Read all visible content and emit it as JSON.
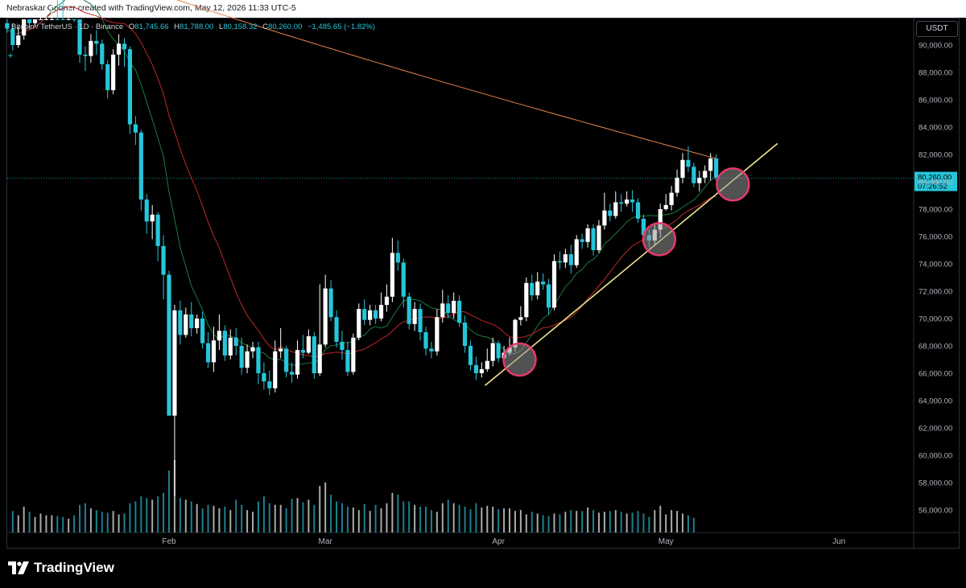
{
  "header": {
    "credit": "NebraskanGooner created with TradingView.com, May 12, 2026 11:33 UTC-5"
  },
  "legend": {
    "symbol": "Bitcoin / TetherUS · 1D · Binance",
    "o_label": "O",
    "o_value": "81,745.66",
    "h_label": "H",
    "h_value": "81,788.00",
    "l_label": "L",
    "l_value": "80,158.32",
    "c_label": "C",
    "c_value": "80,260.00",
    "change": "−1,485.65 (−1.82%)"
  },
  "currency_button": "USDT",
  "price_label": {
    "price": "80,260.00",
    "countdown": "07:26:52"
  },
  "branding": "TradingView",
  "colors": {
    "up": "#ffffff",
    "down": "#26c6da",
    "ma_long": "#e8844a",
    "ma_mid": "#c0282c",
    "ma_short": "#1e7a3a",
    "trendline": "#f0e68c",
    "circle": "#e8386b",
    "background": "#000000"
  },
  "chart_data": {
    "type": "candlestick",
    "symbol": "BTC/USDT",
    "interval": "1D",
    "y_ticks": [
      56000,
      58000,
      60000,
      62000,
      64000,
      66000,
      68000,
      70000,
      72000,
      74000,
      76000,
      78000,
      80000,
      82000,
      84000,
      86000,
      88000,
      90000
    ],
    "x_ticks": [
      {
        "label": "Feb",
        "day": 31
      },
      {
        "label": "Mar",
        "day": 59
      },
      {
        "label": "Apr",
        "day": 90
      },
      {
        "label": "May",
        "day": 120
      },
      {
        "label": "Jun",
        "day": 151
      }
    ],
    "first_date": "2026-01-01",
    "candles": [
      [
        90800,
        90600,
        91300,
        90100
      ],
      [
        90600,
        91600,
        92100,
        90400
      ],
      [
        91600,
        91200,
        92200,
        90900
      ],
      [
        91200,
        90000,
        91600,
        89600
      ],
      [
        90000,
        90700,
        91300,
        89800
      ],
      [
        90700,
        92100,
        92900,
        90400
      ],
      [
        92100,
        91600,
        92600,
        91200
      ],
      [
        91600,
        92700,
        93200,
        91300
      ],
      [
        92700,
        94300,
        95200,
        92500
      ],
      [
        94300,
        95300,
        95700,
        93800
      ],
      [
        95300,
        95500,
        96400,
        94900
      ],
      [
        95500,
        95100,
        95800,
        94600
      ],
      [
        95100,
        94100,
        95300,
        93300
      ],
      [
        94100,
        94600,
        95000,
        93600
      ],
      [
        94600,
        92200,
        94700,
        91700
      ],
      [
        92200,
        89300,
        92500,
        88700
      ],
      [
        89300,
        89200,
        89900,
        88100
      ],
      [
        89200,
        90300,
        90800,
        88700
      ],
      [
        90300,
        90100,
        91100,
        89300
      ],
      [
        90100,
        88600,
        90400,
        88200
      ],
      [
        88600,
        86700,
        88900,
        86100
      ],
      [
        86700,
        89300,
        89700,
        86400
      ],
      [
        89300,
        90100,
        90800,
        88500
      ],
      [
        90100,
        89700,
        90500,
        88400
      ],
      [
        89700,
        84200,
        89900,
        83500
      ],
      [
        84200,
        83600,
        84800,
        82700
      ],
      [
        83600,
        78700,
        83800,
        77900
      ],
      [
        78700,
        77100,
        79100,
        76200
      ],
      [
        77100,
        77600,
        78300,
        75800
      ],
      [
        77600,
        75300,
        77800,
        74200
      ],
      [
        75300,
        73200,
        76100,
        71400
      ],
      [
        73200,
        62900,
        73500,
        62900
      ],
      [
        62900,
        70600,
        71000,
        57000
      ],
      [
        70600,
        68800,
        71300,
        68100
      ],
      [
        68800,
        70300,
        70800,
        68600
      ],
      [
        70300,
        69300,
        71200,
        68700
      ],
      [
        69300,
        70000,
        70300,
        68900
      ],
      [
        70000,
        68200,
        70500,
        67800
      ],
      [
        68200,
        66800,
        69000,
        66400
      ],
      [
        66800,
        68400,
        69400,
        66100
      ],
      [
        68400,
        69100,
        70300,
        67700
      ],
      [
        69100,
        67300,
        69500,
        66900
      ],
      [
        67300,
        68600,
        69200,
        67000
      ],
      [
        68600,
        68000,
        69300,
        67300
      ],
      [
        68000,
        66400,
        68600,
        65900
      ],
      [
        66400,
        67600,
        68100,
        66000
      ],
      [
        67600,
        67900,
        68300,
        67100
      ],
      [
        67900,
        66000,
        68300,
        65200
      ],
      [
        66000,
        65400,
        66800,
        64800
      ],
      [
        65400,
        64900,
        66200,
        64400
      ],
      [
        64900,
        67600,
        68400,
        64600
      ],
      [
        67600,
        67800,
        69300,
        67100
      ],
      [
        67800,
        66100,
        68000,
        65700
      ],
      [
        66100,
        65900,
        66800,
        65300
      ],
      [
        65900,
        67700,
        68400,
        65600
      ],
      [
        67700,
        67500,
        68800,
        67100
      ],
      [
        67500,
        68700,
        69200,
        67400
      ],
      [
        68700,
        66000,
        69000,
        65600
      ],
      [
        66000,
        68100,
        72500,
        65800
      ],
      [
        68100,
        72200,
        73200,
        67900
      ],
      [
        72200,
        70100,
        72800,
        69800
      ],
      [
        70100,
        68300,
        70600,
        67900
      ],
      [
        68300,
        67700,
        69100,
        67000
      ],
      [
        67700,
        66100,
        68300,
        65800
      ],
      [
        66100,
        68600,
        68900,
        65900
      ],
      [
        68600,
        70700,
        71100,
        68400
      ],
      [
        70700,
        69900,
        71400,
        69500
      ],
      [
        69900,
        70600,
        71000,
        69500
      ],
      [
        70600,
        70000,
        71000,
        69600
      ],
      [
        70000,
        71000,
        71900,
        69800
      ],
      [
        71000,
        71600,
        72500,
        70500
      ],
      [
        71600,
        74800,
        75900,
        71200
      ],
      [
        74800,
        74100,
        75700,
        73500
      ],
      [
        74100,
        71600,
        74400,
        70800
      ],
      [
        71600,
        69600,
        71900,
        69200
      ],
      [
        69600,
        70700,
        71200,
        69100
      ],
      [
        70700,
        69000,
        71100,
        68400
      ],
      [
        69000,
        67800,
        69400,
        67300
      ],
      [
        67800,
        67600,
        68300,
        67100
      ],
      [
        67600,
        70100,
        70700,
        67300
      ],
      [
        70100,
        71100,
        72100,
        69700
      ],
      [
        71100,
        70400,
        71700,
        70000
      ],
      [
        70400,
        71300,
        71900,
        70000
      ],
      [
        71300,
        69700,
        71700,
        69400
      ],
      [
        69700,
        68000,
        70200,
        67500
      ],
      [
        68000,
        66600,
        68400,
        66200
      ],
      [
        66600,
        66000,
        67200,
        65500
      ],
      [
        66000,
        66300,
        66800,
        65700
      ],
      [
        66300,
        66900,
        67800,
        66100
      ],
      [
        66900,
        68200,
        68600,
        66500
      ],
      [
        68200,
        67100,
        68400,
        66800
      ],
      [
        67100,
        67500,
        68000,
        66900
      ],
      [
        67500,
        67900,
        68600,
        67300
      ],
      [
        67900,
        69900,
        70000,
        67600
      ],
      [
        69900,
        70100,
        70900,
        69500
      ],
      [
        70100,
        72600,
        73000,
        69800
      ],
      [
        72600,
        71700,
        73200,
        71300
      ],
      [
        71700,
        72700,
        73400,
        71400
      ],
      [
        72700,
        72500,
        73300,
        72100
      ],
      [
        72500,
        70800,
        72900,
        70300
      ],
      [
        70800,
        74200,
        74700,
        70600
      ],
      [
        74200,
        74100,
        74900,
        73600
      ],
      [
        74100,
        74700,
        75100,
        73700
      ],
      [
        74700,
        73900,
        75400,
        73300
      ],
      [
        73900,
        75800,
        76100,
        73700
      ],
      [
        75800,
        75600,
        76200,
        75100
      ],
      [
        75600,
        76600,
        76900,
        75200
      ],
      [
        76600,
        75000,
        76900,
        74600
      ],
      [
        75000,
        76800,
        77200,
        74800
      ],
      [
        76800,
        77900,
        79200,
        76500
      ],
      [
        77900,
        77500,
        78400,
        77100
      ],
      [
        77500,
        78500,
        79300,
        77300
      ],
      [
        78500,
        78400,
        79100,
        77800
      ],
      [
        78400,
        78700,
        79300,
        78200
      ],
      [
        78700,
        78500,
        79400,
        77800
      ],
      [
        78500,
        77300,
        78800,
        77000
      ],
      [
        77300,
        76100,
        77600,
        75800
      ],
      [
        76100,
        75700,
        76500,
        75200
      ],
      [
        75700,
        76500,
        77000,
        75300
      ],
      [
        76500,
        78000,
        78400,
        75900
      ],
      [
        78000,
        78300,
        79100,
        77900
      ],
      [
        78300,
        79200,
        79700,
        77900
      ],
      [
        79200,
        80300,
        80900,
        78900
      ],
      [
        80300,
        81600,
        82100,
        79900
      ],
      [
        81600,
        81100,
        82600,
        80700
      ],
      [
        81100,
        79900,
        81400,
        79600
      ],
      [
        79900,
        80300,
        80800,
        79300
      ],
      [
        80300,
        80800,
        81200,
        79900
      ],
      [
        80800,
        81700,
        82100,
        80100
      ],
      [
        81700,
        80300,
        82000,
        80100
      ]
    ],
    "volume": [
      1800,
      1500,
      1300,
      1250,
      1000,
      1500,
      1200,
      900,
      1100,
      1000,
      1000,
      950,
      900,
      800,
      1000,
      1600,
      1700,
      1400,
      1300,
      1200,
      1150,
      1250,
      1050,
      1100,
      1700,
      1800,
      2100,
      2000,
      1900,
      2100,
      2300,
      3600,
      4200,
      2000,
      1900,
      1800,
      1650,
      1400,
      1600,
      1550,
      1400,
      1500,
      1300,
      1900,
      1600,
      1300,
      1200,
      1800,
      2100,
      1700,
      1600,
      1600,
      1400,
      1950,
      2000,
      1750,
      1900,
      1600,
      2700,
      2900,
      2200,
      1800,
      1700,
      1500,
      1450,
      1300,
      1650,
      1250,
      1600,
      1400,
      1700,
      2300,
      2200,
      1800,
      1800,
      1600,
      1500,
      1500,
      1300,
      1200,
      1700,
      1900,
      1700,
      1600,
      1500,
      1350,
      1700,
      1450,
      1550,
      1500,
      1350,
      1400,
      1400,
      1250,
      1300,
      1050,
      1200,
      1100,
      1000,
      950,
      1100,
      1050,
      1200,
      1300,
      1250,
      1250,
      1450,
      1300,
      1150,
      1200,
      1250,
      1300,
      1200,
      1100,
      1150,
      1250,
      1100,
      900,
      1300,
      1550,
      1050,
      1300,
      1250,
      1100,
      1000,
      850
    ]
  }
}
